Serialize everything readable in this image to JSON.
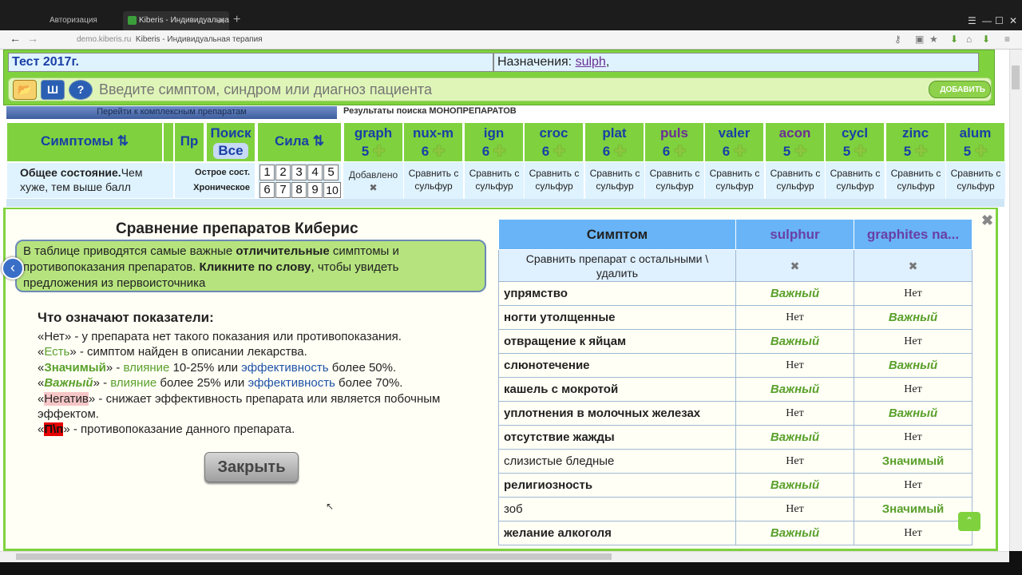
{
  "browser": {
    "tab1_title": "Авторизация",
    "tab2_title": "Kiberis - Индивидуальна",
    "url_domain": "demo.kiberis.ru",
    "url_title": "Kiberis - Индивидуальная терапия"
  },
  "top": {
    "test_title": "Тест 2017г.",
    "assign_label": "Назначения:",
    "assign_value": "sulph",
    "assign_suffix": ",",
    "search_placeholder": "Введите симптом, синдром или диагноз пациента",
    "add_button": "ДОБАВИТЬ",
    "goto_complex": "Перейти к комплексным препаратам",
    "results_label": "Результаты поиска МОНОПРЕПАРАТОВ"
  },
  "header": {
    "symptoms": "Симптомы ⇅",
    "pr": "Пр",
    "search": "Поиск",
    "all": "Все",
    "strength": "Сила ⇅"
  },
  "remedies": [
    {
      "name": "graph",
      "count": "5",
      "color": "#1a3fa5"
    },
    {
      "name": "nux-m",
      "count": "6",
      "color": "#1a3fa5"
    },
    {
      "name": "ign",
      "count": "6",
      "color": "#1a3fa5"
    },
    {
      "name": "croc",
      "count": "6",
      "color": "#1a3fa5"
    },
    {
      "name": "plat",
      "count": "6",
      "color": "#1a3fa5"
    },
    {
      "name": "puls",
      "count": "6",
      "color": "#6b2f95"
    },
    {
      "name": "valer",
      "count": "6",
      "color": "#1a3fa5"
    },
    {
      "name": "acon",
      "count": "5",
      "color": "#6b2f95"
    },
    {
      "name": "cycl",
      "count": "5",
      "color": "#1a3fa5"
    },
    {
      "name": "zinc",
      "count": "5",
      "color": "#1a3fa5"
    },
    {
      "name": "alum",
      "count": "5",
      "color": "#1a3fa5"
    }
  ],
  "row2": {
    "symptom_bold": "Общее состояние.",
    "symptom_rest": "Чем хуже, тем выше балл",
    "acute": "Острое сост.",
    "chronic": "Хроническое",
    "numbers_top": [
      "1",
      "2",
      "3",
      "4",
      "5"
    ],
    "numbers_bottom": [
      "6",
      "7",
      "8",
      "9",
      "10"
    ],
    "added": "Добавлено",
    "compare1": "Сравнить с",
    "compare2": "сульфур"
  },
  "modal": {
    "title": "Сравнение препаратов Киберис",
    "info_1": "В таблице приводятся самые важные ",
    "info_bold1": "отличительные",
    "info_2": " симптомы и противопоказания препаратов. ",
    "info_bold2": "Кликните по слову",
    "info_3": ", чтобы увидеть предложения из первоисточника",
    "legend_title": "Что означают показатели:",
    "l1": "«Нет» - у препарата нет такого показания или противопоказания.",
    "l2_a": "«",
    "l2_b": "Есть",
    "l2_c": "» - симптом найден в описании лекарства.",
    "l3_b": "Значимый",
    "l3_c": "» - ",
    "l3_d": "влияние",
    "l3_e": " 10-25% или ",
    "l3_f": "эффективность",
    "l3_g": " более 50%.",
    "l4_b": "Важный",
    "l4_e": " более 25% или ",
    "l4_g": " более 70%.",
    "l5_b": "Негатив",
    "l5_c": "» - снижает эффективность препарата или является побочным эффектом.",
    "l6_b": "П\\п",
    "l6_c": "» - противопоказание данного препарата.",
    "close": "Закрыть"
  },
  "compare_table": {
    "col_symptom": "Симптом",
    "col_a": "sulphur",
    "col_b": "graphites na...",
    "compare_row": "Сравнить препарат с остальными \\ удалить",
    "rows": [
      {
        "s": "упрямство",
        "bold": true,
        "a": "Важный",
        "b": "Нет"
      },
      {
        "s": "ногти утолщенные",
        "bold": true,
        "a": "Нет",
        "b": "Важный"
      },
      {
        "s": "отвращение к яйцам",
        "bold": true,
        "a": "Важный",
        "b": "Нет"
      },
      {
        "s": "слюнотечение",
        "bold": true,
        "a": "Нет",
        "b": "Важный"
      },
      {
        "s": "кашель с мокротой",
        "bold": true,
        "a": "Важный",
        "b": "Нет"
      },
      {
        "s": "уплотнения в молочных железах",
        "bold": true,
        "a": "Нет",
        "b": "Важный"
      },
      {
        "s": "отсутствие жажды",
        "bold": true,
        "a": "Важный",
        "b": "Нет"
      },
      {
        "s": "слизистые бледные",
        "bold": false,
        "a": "Нет",
        "b": "Значимый"
      },
      {
        "s": "религиозность",
        "bold": true,
        "a": "Важный",
        "b": "Нет"
      },
      {
        "s": "зоб",
        "bold": false,
        "a": "Нет",
        "b": "Значимый"
      },
      {
        "s": "желание алкоголя",
        "bold": true,
        "a": "Важный",
        "b": "Нет"
      }
    ]
  }
}
